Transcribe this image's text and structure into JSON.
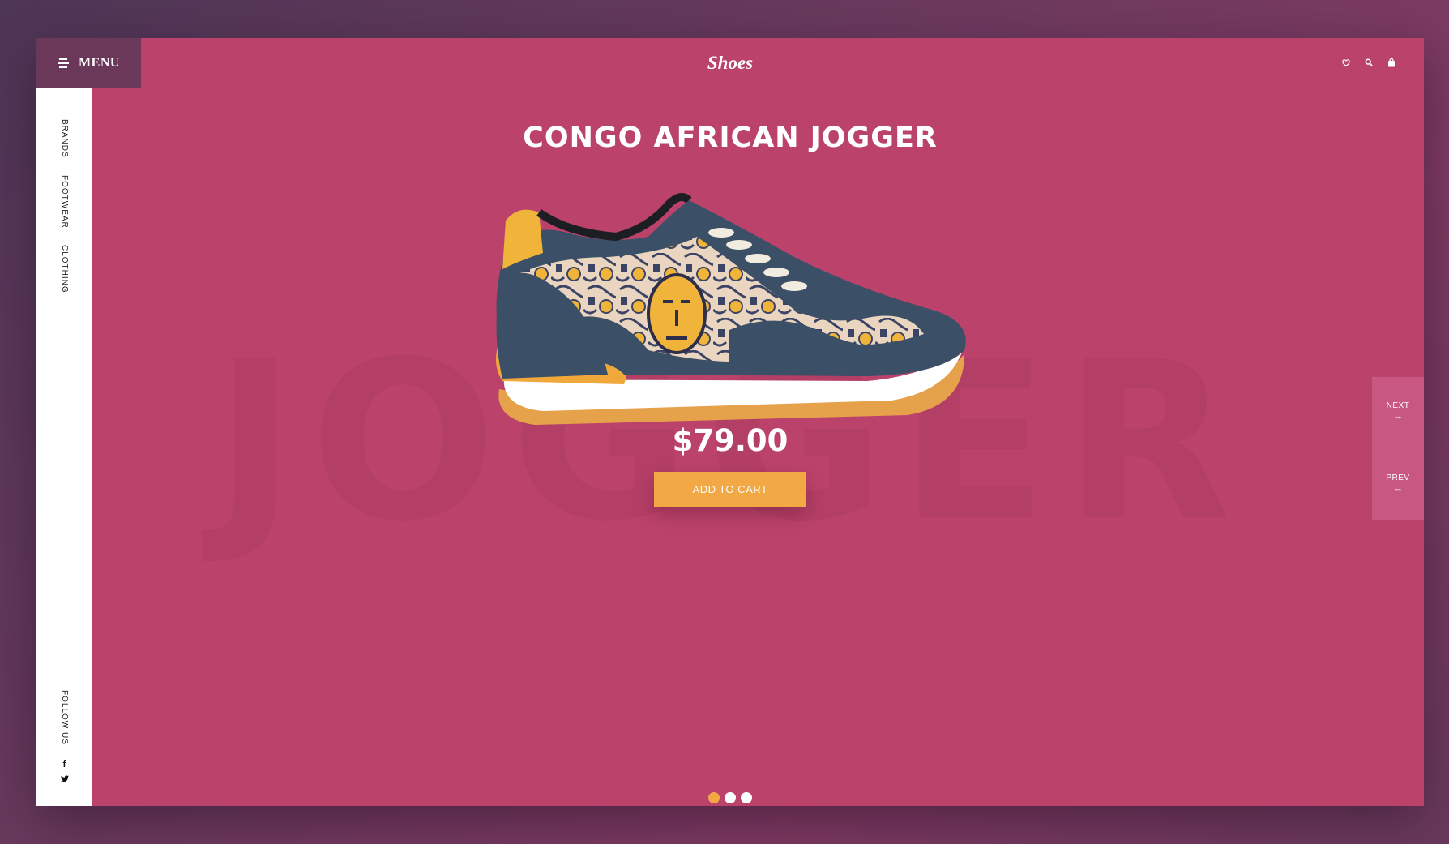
{
  "header": {
    "menu_label": "MENU",
    "brand": "Shoes",
    "icons": [
      "heart-icon",
      "search-icon",
      "bag-icon"
    ]
  },
  "sidebar": {
    "links": [
      "BRANDS",
      "FOOTWEAR",
      "CLOTHING"
    ],
    "follow_label": "FOLLOW US",
    "social": [
      {
        "name": "facebook-icon",
        "glyph": "f"
      },
      {
        "name": "twitter-icon",
        "glyph": "🐦"
      }
    ]
  },
  "product": {
    "title": "CONGO AFRICAN JOGGER",
    "background_word": "JOGGER",
    "price": "$79.00",
    "add_to_cart": "ADD TO CART"
  },
  "pager": {
    "next_label": "NEXT",
    "next_arrow": "→",
    "prev_label": "PREV",
    "prev_arrow": "←"
  },
  "slider": {
    "dots": 3,
    "active_index": 0
  },
  "colors": {
    "background": "#bb436b",
    "menu_bg": "#6b3859",
    "accent": "#f2a945",
    "sidebar_bg": "#ffffff"
  }
}
